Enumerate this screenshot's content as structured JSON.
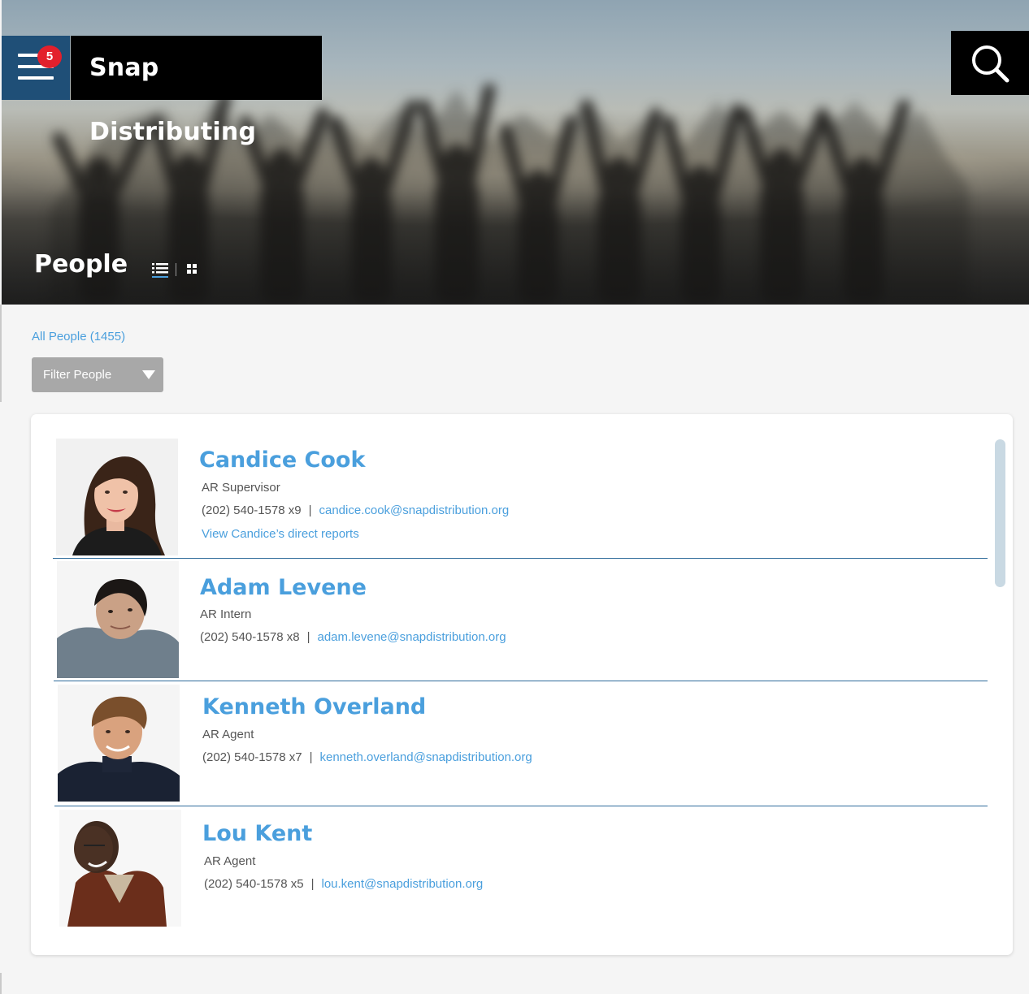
{
  "header": {
    "brand": "Snap Distributing",
    "menu_badge": "5",
    "page_title": "People"
  },
  "filters": {
    "all_people": "All People (1455)",
    "filter_placeholder": "Filter People"
  },
  "people": [
    {
      "name": "Candice Cook",
      "title": "AR Supervisor",
      "phone": "(202) 540-1578 x9",
      "email": "candice.cook@snapdistribution.org",
      "reports_link": "View Candice’s direct reports"
    },
    {
      "name": "Adam Levene",
      "title": "AR Intern",
      "phone": "(202) 540-1578 x8",
      "email": "adam.levene@snapdistribution.org"
    },
    {
      "name": "Kenneth Overland",
      "title": "AR Agent",
      "phone": "(202) 540-1578 x7",
      "email": "kenneth.overland@snapdistribution.org"
    },
    {
      "name": "Lou Kent",
      "title": "AR Agent",
      "phone": "(202) 540-1578 x5",
      "email": "lou.kent@snapdistribution.org"
    }
  ],
  "separator": "|",
  "colors": {
    "accent": "#4a9fdd",
    "menu_bg": "#1f4f77",
    "badge": "#e3202c",
    "row_divider": "#2e6b9b"
  }
}
